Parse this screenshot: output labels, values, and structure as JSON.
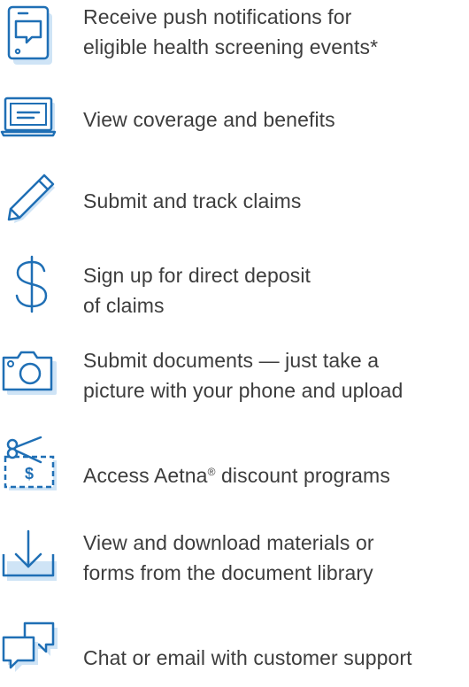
{
  "colors": {
    "icon_stroke": "#1f6fb5",
    "icon_shadow": "#cfe4f6",
    "text": "#3d3d3d"
  },
  "features": [
    {
      "icon": "phone-notification-icon",
      "lines": [
        "Receive push notifications for",
        "eligible health screening events*"
      ]
    },
    {
      "icon": "laptop-icon",
      "lines": [
        "View coverage and benefits"
      ]
    },
    {
      "icon": "pencil-icon",
      "lines": [
        "Submit and track claims"
      ]
    },
    {
      "icon": "dollar-sign-icon",
      "lines": [
        "Sign up for direct deposit",
        "of claims"
      ]
    },
    {
      "icon": "camera-icon",
      "lines": [
        "Submit documents — just take a",
        "picture with your phone and upload"
      ]
    },
    {
      "icon": "discount-coupon-icon",
      "lines": [
        "Access Aetna",
        "discount programs"
      ],
      "registered_mark": "®"
    },
    {
      "icon": "download-icon",
      "lines": [
        "View and download materials or",
        "forms from the document library"
      ]
    },
    {
      "icon": "chat-bubbles-icon",
      "lines": [
        "Chat or email with customer support"
      ]
    }
  ]
}
